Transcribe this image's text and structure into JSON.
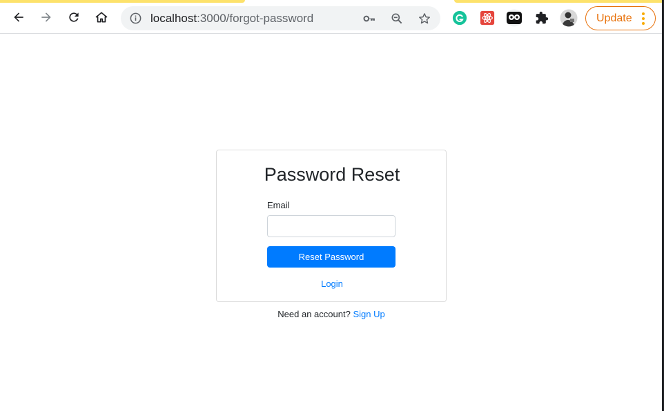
{
  "browser": {
    "url_host": "localhost",
    "url_path": ":3000/forgot-password",
    "update_label": "Update",
    "colors": {
      "accent_strip": "#fde26b",
      "update_orange": "#e8710a",
      "omnibox_bg": "#f1f3f4"
    },
    "icons": {
      "back": "arrow-left-icon",
      "forward": "arrow-right-icon",
      "reload": "reload-icon",
      "home": "home-icon",
      "info": "info-icon",
      "key": "key-icon",
      "zoom": "zoom-out-icon",
      "star": "star-icon",
      "extensions": [
        "grammarly-icon",
        "react-devtools-icon",
        "owl-extension-icon",
        "puzzle-icon",
        "profile-avatar"
      ]
    }
  },
  "page": {
    "title": "Password Reset",
    "email_label": "Email",
    "email_value": "",
    "reset_button": "Reset Password",
    "login_link": "Login",
    "footer_text": "Need an account?",
    "signup_link": "Sign Up",
    "colors": {
      "primary": "#007bff",
      "text": "#212529"
    }
  }
}
